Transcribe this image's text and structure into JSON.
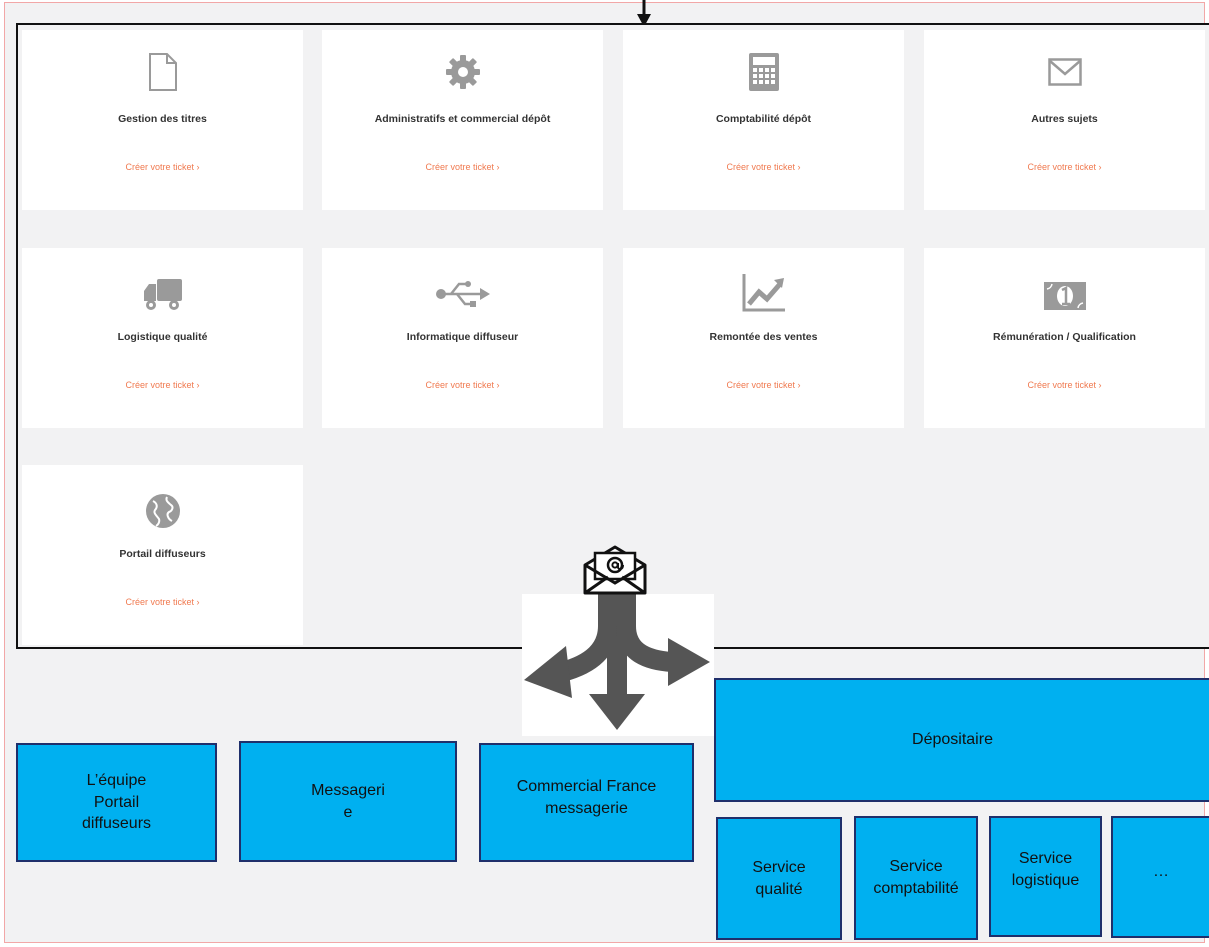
{
  "cards": [
    {
      "title": "Gestion des titres",
      "link": "Créer votre ticket ›",
      "icon": "document-icon"
    },
    {
      "title": "Administratifs et commercial dépôt",
      "link": "Créer votre ticket ›",
      "icon": "gear-icon"
    },
    {
      "title": "Comptabilité dépôt",
      "link": "Créer votre ticket ›",
      "icon": "calculator-icon"
    },
    {
      "title": "Autres sujets",
      "link": "Créer votre ticket ›",
      "icon": "envelope-icon"
    },
    {
      "title": "Logistique qualité",
      "link": "Créer votre ticket ›",
      "icon": "truck-icon"
    },
    {
      "title": "Informatique diffuseur",
      "link": "Créer votre ticket ›",
      "icon": "usb-icon"
    },
    {
      "title": "Remontée des ventes",
      "link": "Créer votre ticket ›",
      "icon": "chart-up-icon"
    },
    {
      "title": "Rémunération / Qualification",
      "link": "Créer votre ticket ›",
      "icon": "banknote-icon"
    },
    {
      "title": "Portail diffuseurs",
      "link": "Créer votre ticket ›",
      "icon": "globe-icon"
    }
  ],
  "boxes": {
    "equipe_line1": "L’équipe",
    "equipe_line2": "Portail",
    "equipe_line3": "diffuseurs",
    "messagerie_line1": "Messageri",
    "messagerie_line2": "e",
    "commercial_line1": "Commercial France",
    "commercial_line2": "messagerie",
    "depositaire": "Dépositaire",
    "qualite_line1": "Service",
    "qualite_line2": "qualité",
    "comptabilite_line1": "Service",
    "comptabilite_line2": "comptabilité",
    "logistique_line1": "Service",
    "logistique_line2": "logistique",
    "more": "…"
  },
  "colors": {
    "box_fill": "#00b0f0",
    "box_border": "#1f2f6b",
    "link": "#f07a50",
    "icon": "#9a9a9a"
  }
}
